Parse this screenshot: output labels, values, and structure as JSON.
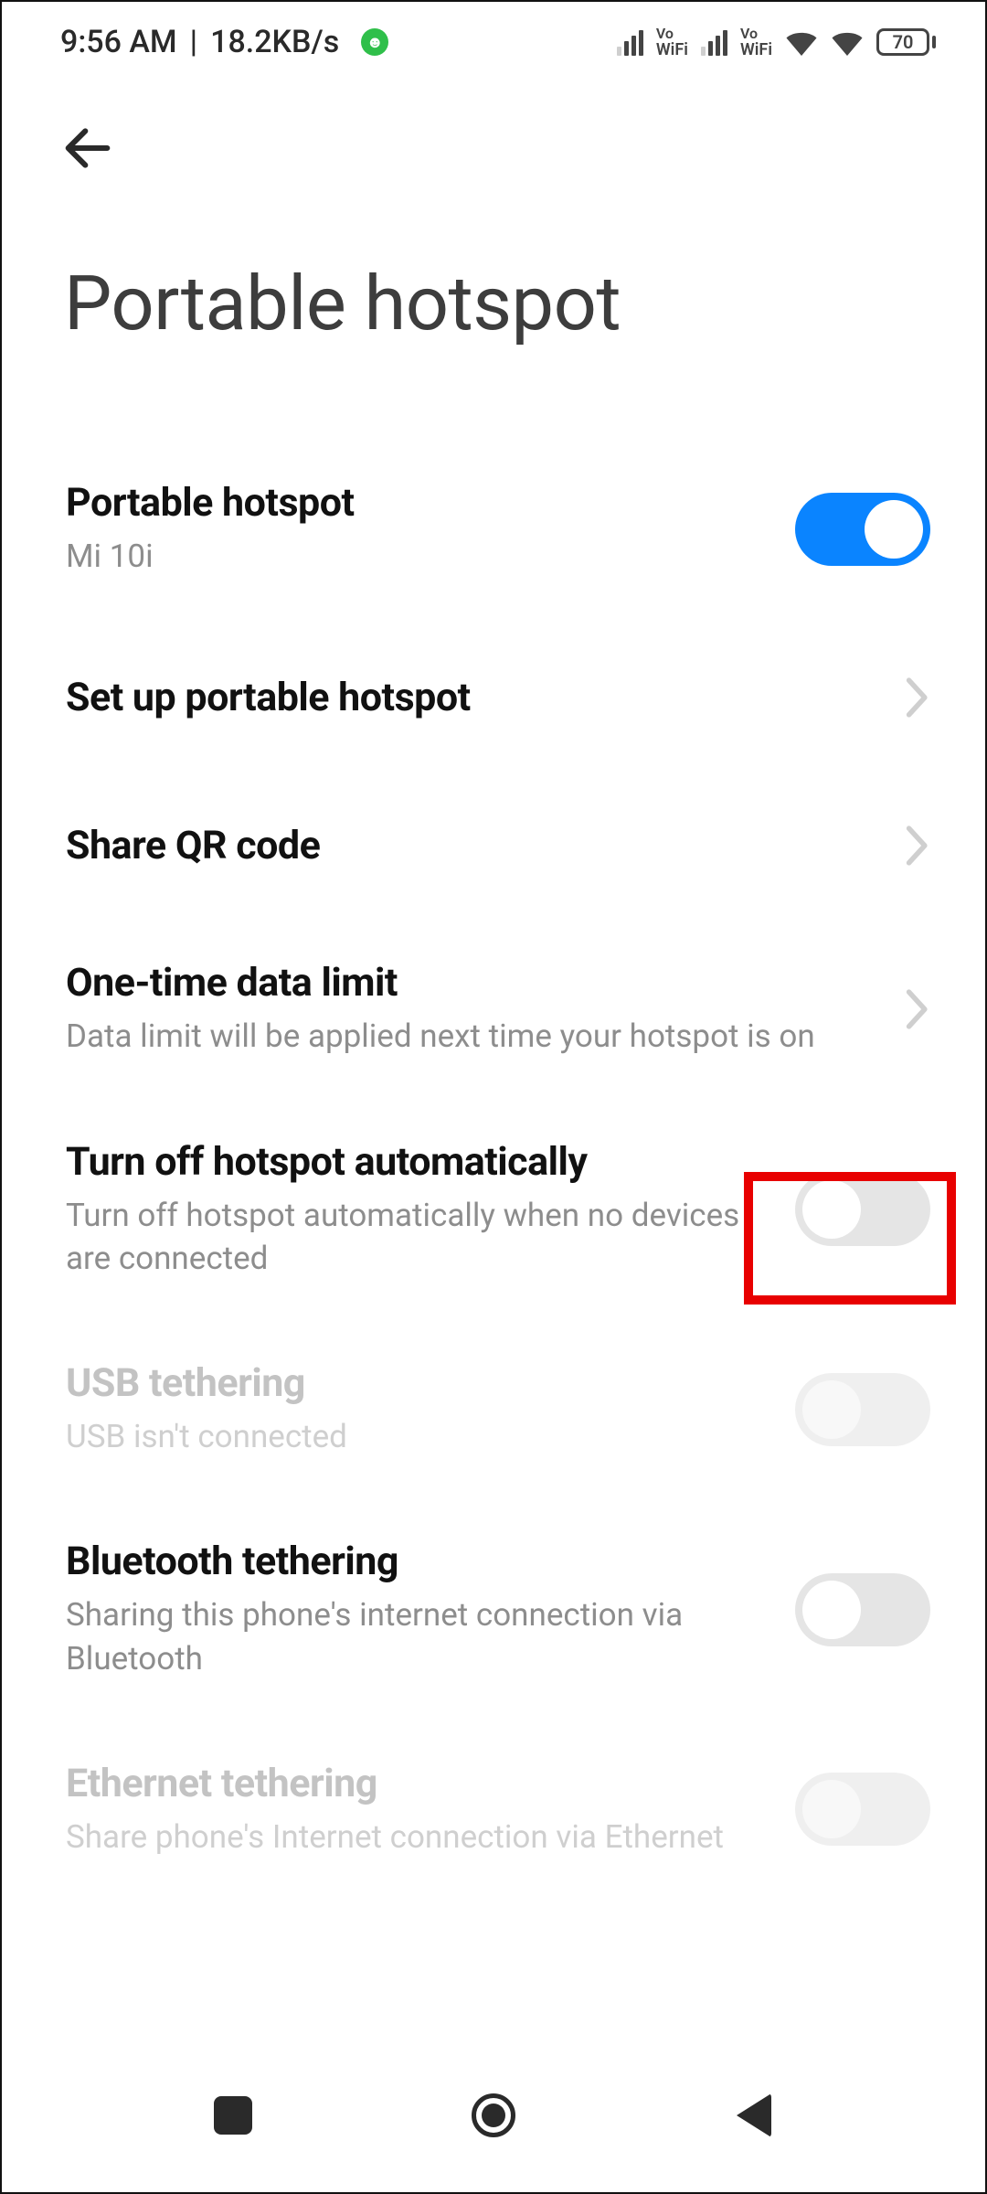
{
  "status": {
    "time": "9:56 AM",
    "net_rate": "18.2KB/s",
    "vo_label": "Vo",
    "wifi_label": "WiFi",
    "battery_pct": "70"
  },
  "header": {
    "title": "Portable hotspot"
  },
  "rows": {
    "hotspot": {
      "title": "Portable hotspot",
      "sub": "Mi 10i"
    },
    "setup": {
      "title": "Set up portable hotspot"
    },
    "qr": {
      "title": "Share QR code"
    },
    "limit": {
      "title": "One-time data limit",
      "sub": "Data limit will be applied next time your hotspot is on"
    },
    "auto_off": {
      "title": "Turn off hotspot automatically",
      "sub": "Turn off hotspot automatically when no devices are connected"
    },
    "usb": {
      "title": "USB tethering",
      "sub": "USB isn't connected"
    },
    "bt": {
      "title": "Bluetooth tethering",
      "sub": "Sharing this phone's internet connection via Bluetooth"
    },
    "eth": {
      "title": "Ethernet tethering",
      "sub": "Share phone's Internet connection via Ethernet"
    }
  },
  "highlight": {
    "target": "auto_off_toggle"
  }
}
